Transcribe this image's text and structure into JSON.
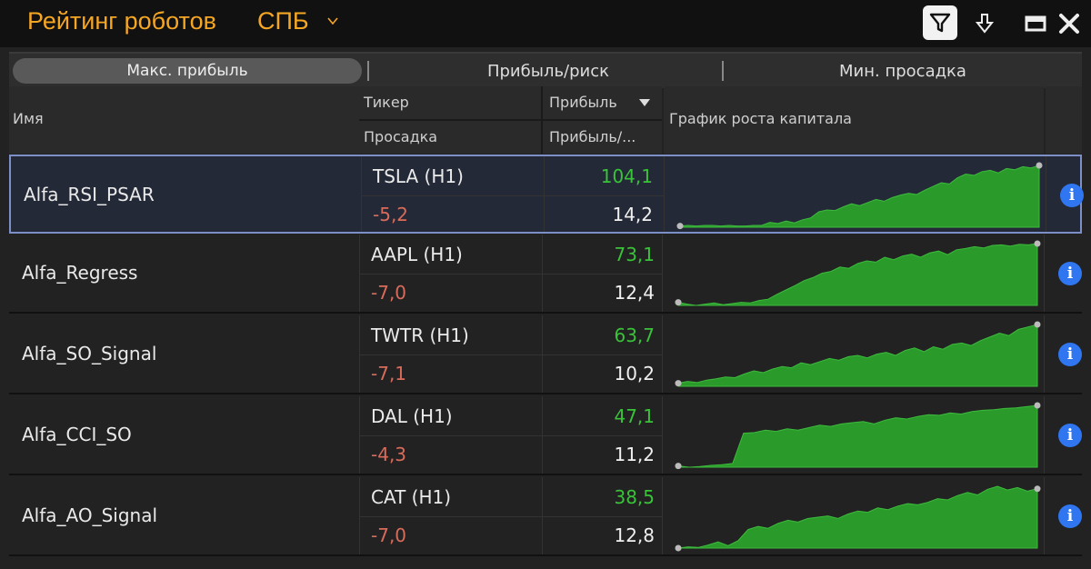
{
  "header": {
    "title": "Рейтинг роботов",
    "market": "СПБ"
  },
  "tabs": [
    "Макс. прибыль",
    "Прибыль/риск",
    "Мин. просадка"
  ],
  "columns": {
    "name": "Имя",
    "ticker": "Тикер",
    "drawdown": "Просадка",
    "profit": "Прибыль",
    "ratio": "Прибыль/...",
    "chart": "График роста капитала"
  },
  "colors": {
    "accent": "#f5a623",
    "profit": "#39c339",
    "drawdown": "#d96b5b",
    "chart_fill": "#2a9a2a",
    "info": "#2f76f0"
  },
  "robots": [
    {
      "name": "Alfa_RSI_PSAR",
      "ticker": "TSLA (H1)",
      "profit": "104,1",
      "drawdown": "-5,2",
      "ratio": "14,2"
    },
    {
      "name": "Alfa_Regress",
      "ticker": "AAPL (H1)",
      "profit": "73,1",
      "drawdown": "-7,0",
      "ratio": "12,4"
    },
    {
      "name": "Alfa_SO_Signal",
      "ticker": "TWTR (H1)",
      "profit": "63,7",
      "drawdown": "-7,1",
      "ratio": "10,2"
    },
    {
      "name": "Alfa_CCI_SO",
      "ticker": "DAL (H1)",
      "profit": "47,1",
      "drawdown": "-4,3",
      "ratio": "11,2"
    },
    {
      "name": "Alfa_AO_Signal",
      "ticker": "CAT (H1)",
      "profit": "38,5",
      "drawdown": "-7,0",
      "ratio": "12,8"
    }
  ],
  "icons": [
    "filter-icon",
    "download-icon",
    "minimize-icon",
    "close-icon",
    "chevron-down-icon",
    "info-icon"
  ]
}
